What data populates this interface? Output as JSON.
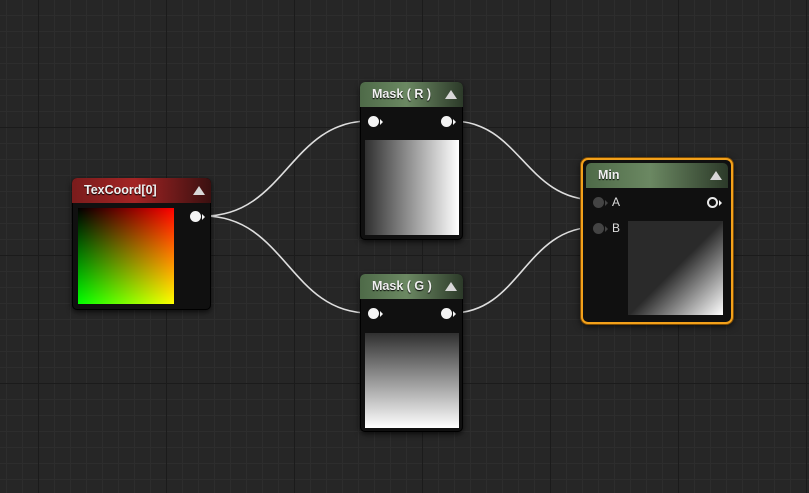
{
  "colors": {
    "background": "#262626",
    "wire": "#dedede",
    "selection": "#f3a11b",
    "header_texcoord": "#a32424",
    "header_mask": "#6b8862"
  },
  "nodes": {
    "texcoord": {
      "title": "TexCoord[0]",
      "icon": "collapse-triangle-icon"
    },
    "mask_r": {
      "title": "Mask ( R )",
      "icon": "collapse-triangle-icon"
    },
    "mask_g": {
      "title": "Mask ( G )",
      "icon": "collapse-triangle-icon"
    },
    "min": {
      "title": "Min",
      "selected": true,
      "inputs": [
        "A",
        "B"
      ],
      "icon": "collapse-triangle-icon"
    }
  }
}
